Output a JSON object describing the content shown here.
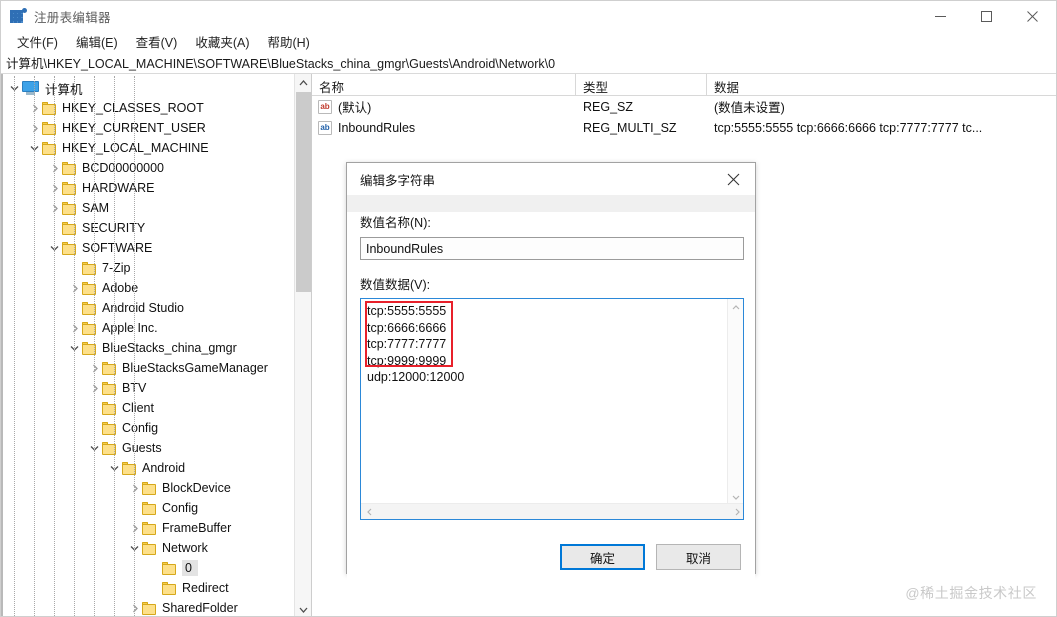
{
  "window": {
    "title": "注册表编辑器",
    "icon": "registry-grid-icon",
    "controls": {
      "minimize": "minimize-icon",
      "maximize": "maximize-icon",
      "close": "close-icon"
    }
  },
  "menubar": {
    "items": [
      {
        "label": "文件(F)"
      },
      {
        "label": "编辑(E)"
      },
      {
        "label": "查看(V)"
      },
      {
        "label": "收藏夹(A)"
      },
      {
        "label": "帮助(H)"
      }
    ]
  },
  "address": {
    "path": "计算机\\HKEY_LOCAL_MACHINE\\SOFTWARE\\BlueStacks_china_gmgr\\Guests\\Android\\Network\\0"
  },
  "tree": {
    "nodes": [
      {
        "label": "计算机",
        "depth": 0,
        "expander": "down",
        "icon": "monitor",
        "selected": false
      },
      {
        "label": "HKEY_CLASSES_ROOT",
        "depth": 1,
        "expander": "right",
        "icon": "folder",
        "selected": false
      },
      {
        "label": "HKEY_CURRENT_USER",
        "depth": 1,
        "expander": "right",
        "icon": "folder",
        "selected": false
      },
      {
        "label": "HKEY_LOCAL_MACHINE",
        "depth": 1,
        "expander": "down",
        "icon": "folder",
        "selected": false
      },
      {
        "label": "BCD00000000",
        "depth": 2,
        "expander": "right",
        "icon": "folder",
        "selected": false
      },
      {
        "label": "HARDWARE",
        "depth": 2,
        "expander": "right",
        "icon": "folder",
        "selected": false
      },
      {
        "label": "SAM",
        "depth": 2,
        "expander": "right",
        "icon": "folder",
        "selected": false
      },
      {
        "label": "SECURITY",
        "depth": 2,
        "expander": "none",
        "icon": "folder",
        "selected": false
      },
      {
        "label": "SOFTWARE",
        "depth": 2,
        "expander": "down",
        "icon": "folder",
        "selected": false
      },
      {
        "label": "7-Zip",
        "depth": 3,
        "expander": "none",
        "icon": "folder",
        "selected": false
      },
      {
        "label": "Adobe",
        "depth": 3,
        "expander": "right",
        "icon": "folder",
        "selected": false
      },
      {
        "label": "Android Studio",
        "depth": 3,
        "expander": "none",
        "icon": "folder",
        "selected": false
      },
      {
        "label": "Apple Inc.",
        "depth": 3,
        "expander": "right",
        "icon": "folder",
        "selected": false
      },
      {
        "label": "BlueStacks_china_gmgr",
        "depth": 3,
        "expander": "down",
        "icon": "folder",
        "selected": false
      },
      {
        "label": "BlueStacksGameManager",
        "depth": 4,
        "expander": "right",
        "icon": "folder",
        "selected": false
      },
      {
        "label": "BTV",
        "depth": 4,
        "expander": "right",
        "icon": "folder",
        "selected": false
      },
      {
        "label": "Client",
        "depth": 4,
        "expander": "none",
        "icon": "folder",
        "selected": false
      },
      {
        "label": "Config",
        "depth": 4,
        "expander": "none",
        "icon": "folder",
        "selected": false
      },
      {
        "label": "Guests",
        "depth": 4,
        "expander": "down",
        "icon": "folder",
        "selected": false
      },
      {
        "label": "Android",
        "depth": 5,
        "expander": "down",
        "icon": "folder",
        "selected": false
      },
      {
        "label": "BlockDevice",
        "depth": 6,
        "expander": "right",
        "icon": "folder",
        "selected": false
      },
      {
        "label": "Config",
        "depth": 6,
        "expander": "none",
        "icon": "folder",
        "selected": false
      },
      {
        "label": "FrameBuffer",
        "depth": 6,
        "expander": "right",
        "icon": "folder",
        "selected": false
      },
      {
        "label": "Network",
        "depth": 6,
        "expander": "down",
        "icon": "folder",
        "selected": false
      },
      {
        "label": "0",
        "depth": 7,
        "expander": "none",
        "icon": "folder",
        "selected": true
      },
      {
        "label": "Redirect",
        "depth": 7,
        "expander": "none",
        "icon": "folder",
        "selected": false
      },
      {
        "label": "SharedFolder",
        "depth": 6,
        "expander": "right",
        "icon": "folder",
        "selected": false
      }
    ]
  },
  "values": {
    "columns": [
      {
        "label": "名称"
      },
      {
        "label": "类型"
      },
      {
        "label": "数据"
      }
    ],
    "rows": [
      {
        "name": "(默认)",
        "type": "REG_SZ",
        "data": "(数值未设置)",
        "icon": "ab-string-icon",
        "icon_color": "red"
      },
      {
        "name": "InboundRules",
        "type": "REG_MULTI_SZ",
        "data": "tcp:5555:5555 tcp:6666:6666 tcp:7777:7777 tc...",
        "icon": "ab-string-icon",
        "icon_color": "blue"
      }
    ]
  },
  "dialog": {
    "title": "编辑多字符串",
    "close_icon": "close-icon",
    "name_label": "数值名称(N):",
    "name_value": "InboundRules",
    "name_placeholder": "",
    "data_label": "数值数据(V):",
    "data_value": "tcp:5555:5555\ntcp:6666:6666\ntcp:7777:7777\ntcp:9999:9999\nudp:12000:12000",
    "ok_label": "确定",
    "cancel_label": "取消",
    "highlight_color": "#e8202a",
    "focus_color": "#0078d7"
  },
  "watermark": {
    "text": "@稀土掘金技术社区"
  }
}
